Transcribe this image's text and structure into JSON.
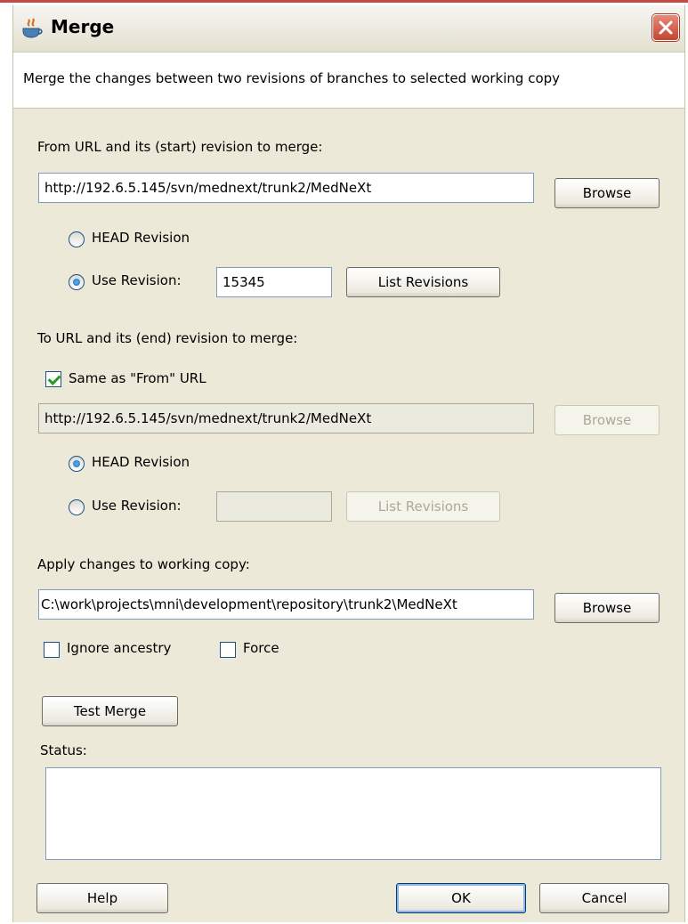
{
  "window": {
    "title": "Merge"
  },
  "description": "Merge the changes between two revisions of branches to selected working copy",
  "from": {
    "label": "From URL and its (start) revision to merge:",
    "url": "http://192.6.5.145/svn/mednext/trunk2/MedNeXt",
    "browse_label": "Browse",
    "head_label": "HEAD Revision",
    "use_label": "Use Revision:",
    "revision_value": "15345",
    "list_label": "List Revisions",
    "selected": "use"
  },
  "to": {
    "label": "To URL and its (end) revision to merge:",
    "same_label": "Same as \"From\" URL",
    "same_checked": true,
    "url": "http://192.6.5.145/svn/mednext/trunk2/MedNeXt",
    "browse_label": "Browse",
    "head_label": "HEAD Revision",
    "use_label": "Use Revision:",
    "revision_value": "",
    "list_label": "List Revisions",
    "selected": "head"
  },
  "apply": {
    "label": "Apply changes to working copy:",
    "path": "C:\\work\\projects\\mni\\development\\repository\\trunk2\\MedNeXt",
    "browse_label": "Browse",
    "ignore_label": "Ignore ancestry",
    "force_label": "Force"
  },
  "test_merge_label": "Test Merge",
  "status_label": "Status:",
  "buttons": {
    "help": "Help",
    "ok": "OK",
    "cancel": "Cancel"
  },
  "colors": {
    "title_close": "#c3452f",
    "focus_border": "#003c74"
  }
}
